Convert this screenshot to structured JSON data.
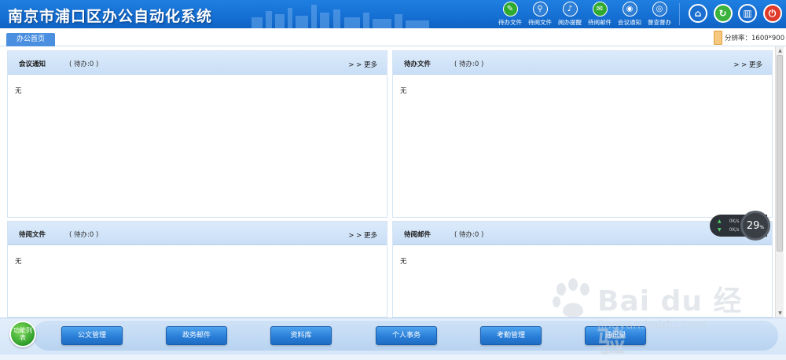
{
  "header": {
    "title": "南京市浦口区办公自动化系统",
    "quick_nav": [
      {
        "label": "待办文件",
        "icon": "edit-icon"
      },
      {
        "label": "待阅文件",
        "icon": "search-icon"
      },
      {
        "label": "阅办提醒",
        "icon": "bell-icon"
      },
      {
        "label": "待阅邮件",
        "icon": "mail-icon"
      },
      {
        "label": "会议通知",
        "icon": "broadcast-icon"
      },
      {
        "label": "督查督办",
        "icon": "eye-icon"
      }
    ],
    "system_buttons": [
      "home-icon",
      "refresh-icon",
      "books-icon",
      "power-icon"
    ]
  },
  "tabs": {
    "home": "办公首页"
  },
  "resolution": "分辨率：1600*900",
  "panels": [
    {
      "title": "会议通知",
      "count": "( 待办:0 )",
      "more": "> > 更多",
      "body": "无"
    },
    {
      "title": "待办文件",
      "count": "( 待办:0 )",
      "more": "> > 更多",
      "body": "无"
    },
    {
      "title": "待阅文件",
      "count": "( 待办:0 )",
      "more": "> > 更多",
      "body": "无"
    },
    {
      "title": "待阅邮件",
      "count": "( 待办:0 )",
      "more": "",
      "body": "无"
    }
  ],
  "net_widget": {
    "up": "0K/s",
    "down": "0K/s",
    "percent": "29",
    "percent_unit": "%"
  },
  "bottom": {
    "func_list": "功能列表",
    "modules": [
      "公文管理",
      "政务邮件",
      "资料库",
      "个人事务",
      "考勤管理",
      "通讯录"
    ]
  },
  "watermark": {
    "brand": "Bai du 经验",
    "url": "jingyan.baidu.com"
  },
  "colors": {
    "header_blue": "#1670d4",
    "panel_head": "#c9def6",
    "module_button": "#2a7fd8",
    "power_red": "#e03a2a",
    "func_green": "#2f9e2a"
  }
}
